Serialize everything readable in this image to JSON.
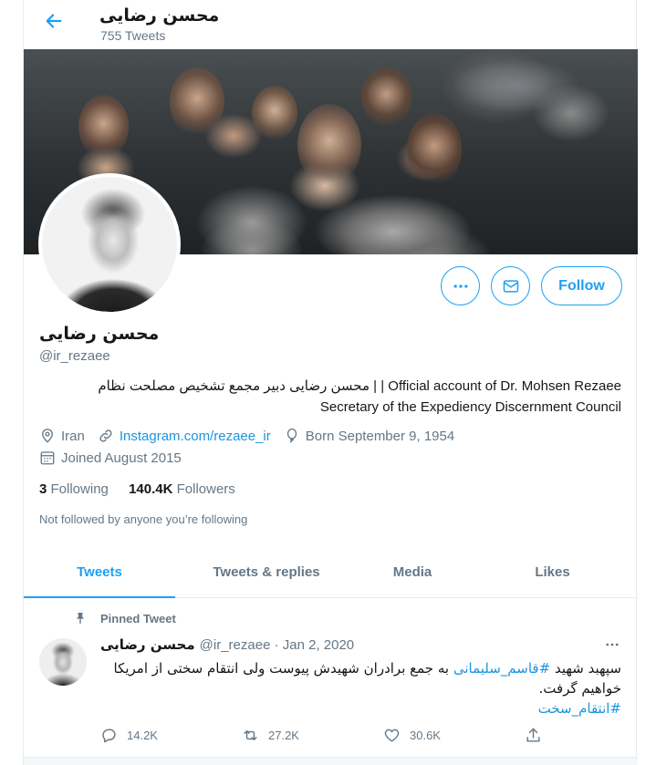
{
  "topbar": {
    "name": "محسن رضایی",
    "tweet_count": "755 Tweets"
  },
  "profile": {
    "name": "محسن رضایی",
    "handle": "@ir_rezaee",
    "bio_line1": "محسن رضایی دبیر مجمع تشخیص مصلحت نظام | | Official account of Dr. Mohsen Rezaee",
    "bio_line2": "Secretary of the Expediency Discernment Council",
    "location": "Iran",
    "website": "Instagram.com/rezaee_ir",
    "born": "Born September 9, 1954",
    "joined": "Joined August 2015",
    "following_count": "3",
    "following_label": "Following",
    "followers_count": "140.4K",
    "followers_label": "Followers",
    "not_followed": "Not followed by anyone you’re following"
  },
  "buttons": {
    "follow": "Follow"
  },
  "tabs": [
    {
      "label": "Tweets",
      "active": true
    },
    {
      "label": "Tweets & replies",
      "active": false
    },
    {
      "label": "Media",
      "active": false
    },
    {
      "label": "Likes",
      "active": false
    }
  ],
  "pinned_tweet": {
    "pinned_label": "Pinned Tweet",
    "name": "محسن رضایی",
    "handle_date": "@ir_rezaee · Jan 2, 2020",
    "text_before": "سپهبد شهید ",
    "hashtag1": "#قاسم_سلیمانی",
    "text_after": " به جمع برادران شهیدش پیوست ولی انتقام سختی از امریکا خواهیم گرفت.",
    "hashtag2": "#انتقام_سخت",
    "replies": "14.2K",
    "retweets": "27.2K",
    "likes": "30.6K"
  },
  "colors": {
    "accent": "#1da1f2",
    "secondary_text": "#657786",
    "link": "#1b95e0"
  },
  "icons": {
    "back": "arrow-left-icon",
    "more": "more-horizontal-icon",
    "mail": "envelope-icon",
    "location": "location-pin-icon",
    "link": "link-icon",
    "birthday": "balloon-icon",
    "calendar": "calendar-icon",
    "pin": "pin-icon",
    "reply": "reply-icon",
    "retweet": "retweet-icon",
    "like": "heart-icon",
    "share": "share-icon"
  }
}
